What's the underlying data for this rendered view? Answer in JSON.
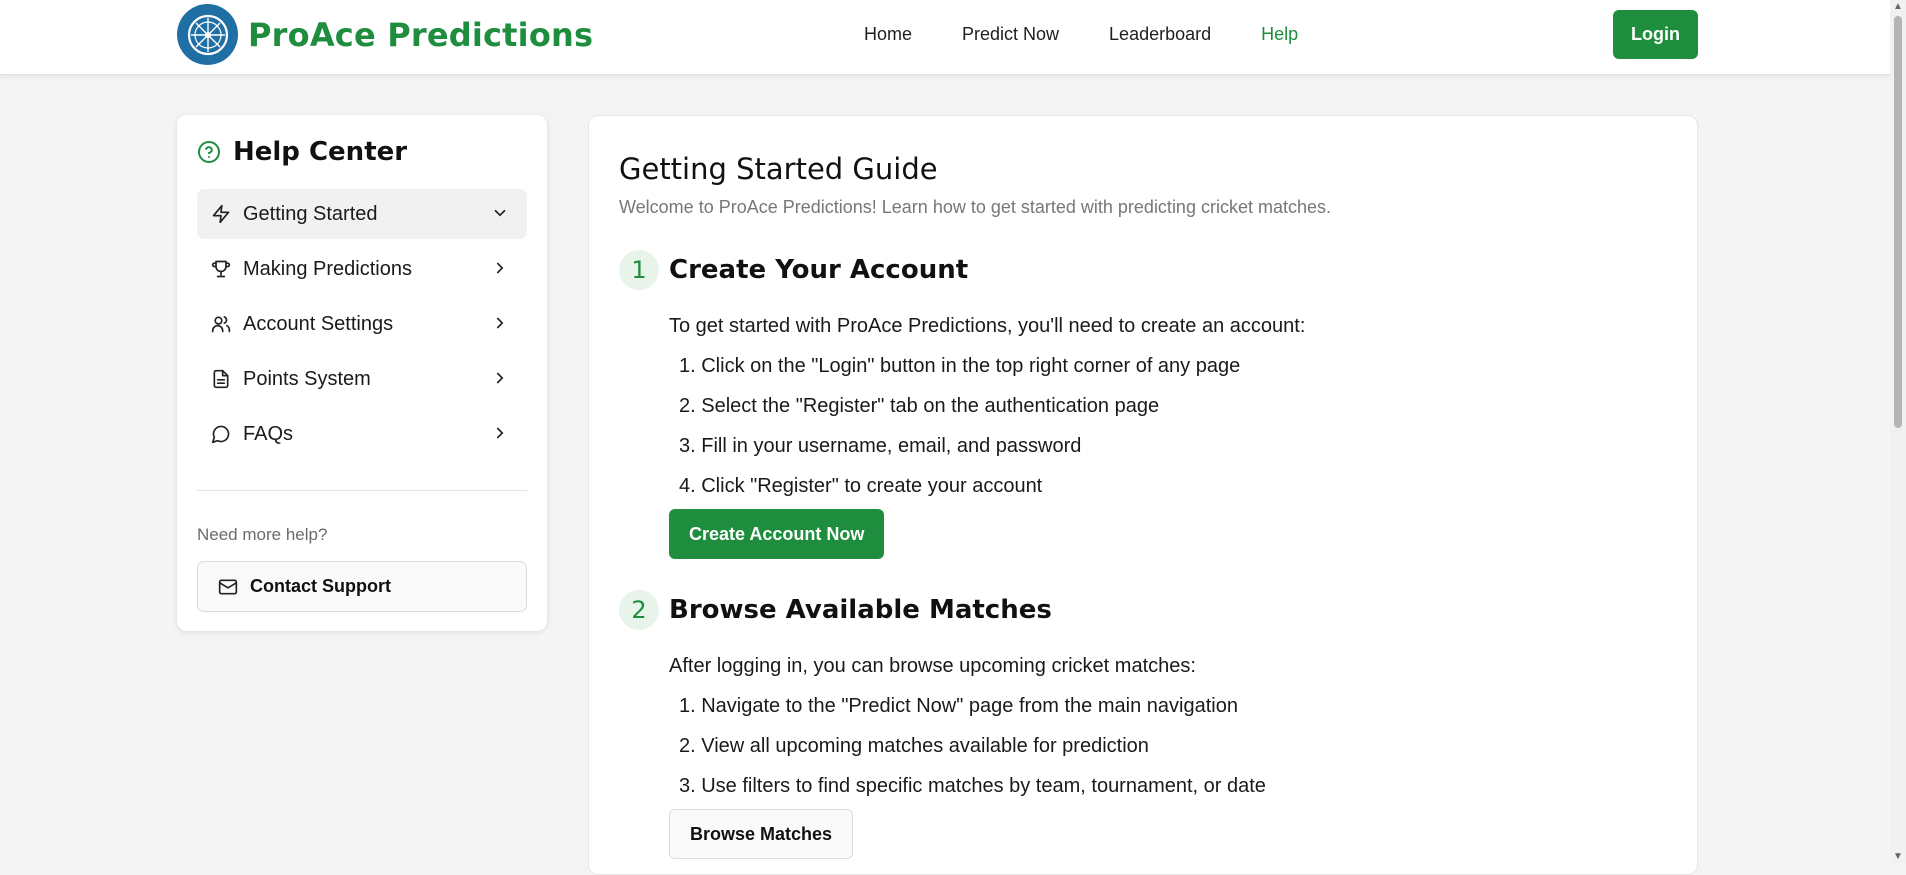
{
  "header": {
    "brand_name": "ProAce Predictions",
    "nav": [
      {
        "label": "Home",
        "active": false
      },
      {
        "label": "Predict Now",
        "active": false
      },
      {
        "label": "Leaderboard",
        "active": false
      },
      {
        "label": "Help",
        "active": true
      }
    ],
    "login_label": "Login"
  },
  "colors": {
    "brand_green": "#1e8e3e",
    "logo_blue": "#1f6fa4"
  },
  "sidebar": {
    "title": "Help Center",
    "title_icon": "help-circle-icon",
    "items": [
      {
        "label": "Getting Started",
        "icon": "lightning-icon",
        "expanded": true
      },
      {
        "label": "Making Predictions",
        "icon": "trophy-icon",
        "expanded": false
      },
      {
        "label": "Account Settings",
        "icon": "users-icon",
        "expanded": false
      },
      {
        "label": "Points System",
        "icon": "document-icon",
        "expanded": false
      },
      {
        "label": "FAQs",
        "icon": "chat-icon",
        "expanded": false
      }
    ],
    "need_help": "Need more help?",
    "contact_label": "Contact Support",
    "contact_icon": "mail-icon"
  },
  "main": {
    "title": "Getting Started Guide",
    "subtitle": "Welcome to ProAce Predictions! Learn how to get started with predicting cricket matches.",
    "steps": [
      {
        "number": "1",
        "title": "Create Your Account",
        "intro": "To get started with ProAce Predictions, you'll need to create an account:",
        "items": [
          "1. Click on the \"Login\" button in the top right corner of any page",
          "2. Select the \"Register\" tab on the authentication page",
          "3. Fill in your username, email, and password",
          "4. Click \"Register\" to create your account"
        ],
        "button": "Create Account Now"
      },
      {
        "number": "2",
        "title": "Browse Available Matches",
        "intro": "After logging in, you can browse upcoming cricket matches:",
        "items": [
          "1. Navigate to the \"Predict Now\" page from the main navigation",
          "2. View all upcoming matches available for prediction",
          "3. Use filters to find specific matches by team, tournament, or date"
        ],
        "button": "Browse Matches"
      }
    ]
  }
}
